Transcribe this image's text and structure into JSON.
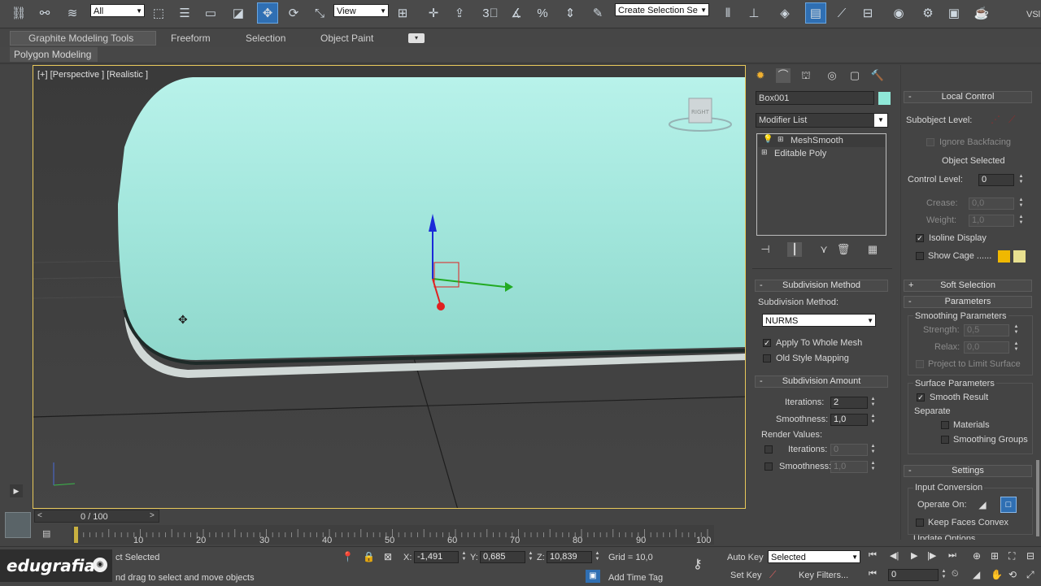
{
  "toolbar": {
    "selection_filter": "All",
    "ref_coord": "View",
    "named_selection_placeholder": "Create Selection Se",
    "icons": [
      "link-icon",
      "unlink-icon",
      "bind-spacewarp-icon",
      "select-object-icon",
      "select-by-name-icon",
      "rect-selection-icon",
      "window-crossing-icon",
      "move-icon",
      "rotate-icon",
      "scale-icon",
      "mirror-snap-icon",
      "pivot-icon",
      "snap-3-icon",
      "angle-snap-icon",
      "percent-snap-icon",
      "spinner-snap-icon",
      "edit-named-sets-icon",
      "mirror-icon",
      "align-icon",
      "layer-icon",
      "graphite-icon",
      "curve-editor-icon",
      "schematic-icon",
      "material-editor-icon",
      "render-setup-icon",
      "render-frame-icon",
      "teapot-icon",
      "render-icon"
    ],
    "right_label": "VSl"
  },
  "ribbon": {
    "tabs": [
      "Graphite Modeling Tools",
      "Freeform",
      "Selection",
      "Object Paint"
    ],
    "sub_tab": "Polygon Modeling"
  },
  "viewport": {
    "label": "[+] [Perspective ] [Realistic ]",
    "viewcube_label": "RIGHT"
  },
  "command_panel": {
    "object_name": "Box001",
    "modifier_list": "Modifier List",
    "stack": [
      "MeshSmooth",
      "Editable Poly"
    ],
    "subdivision_method": {
      "title": "Subdivision Method",
      "label": "Subdivision Method:",
      "value": "NURMS",
      "apply_whole_mesh": "Apply To Whole Mesh",
      "old_style_mapping": "Old Style Mapping"
    },
    "subdivision_amount": {
      "title": "Subdivision Amount",
      "iterations_label": "Iterations:",
      "iterations_value": "2",
      "smoothness_label": "Smoothness:",
      "smoothness_value": "1,0",
      "render_values": "Render Values:",
      "r_iterations_value": "0",
      "r_smoothness_value": "1,0"
    }
  },
  "right_panel": {
    "local_control": {
      "title": "Local Control",
      "subobject_level": "Subobject Level:",
      "ignore_backfacing": "Ignore Backfacing",
      "object_selected": "Object Selected",
      "control_level_label": "Control Level:",
      "control_level_value": "0",
      "crease_label": "Crease:",
      "crease_value": "0,0",
      "weight_label": "Weight:",
      "weight_value": "1,0",
      "isoline_display": "Isoline Display",
      "show_cage": "Show Cage ......",
      "cage_color_1": "#f0b800",
      "cage_color_2": "#e8e090"
    },
    "soft_selection": {
      "title": "Soft Selection"
    },
    "parameters": {
      "title": "Parameters",
      "smoothing_params": "Smoothing Parameters",
      "strength_label": "Strength:",
      "strength_value": "0,5",
      "relax_label": "Relax:",
      "relax_value": "0,0",
      "project_limit": "Project to Limit Surface",
      "surface_params": "Surface Parameters",
      "smooth_result": "Smooth Result",
      "separate": "Separate",
      "materials": "Materials",
      "smoothing_groups": "Smoothing Groups"
    },
    "settings": {
      "title": "Settings",
      "input_conversion": "Input Conversion",
      "operate_on": "Operate On:",
      "keep_faces_convex": "Keep Faces Convex",
      "update_options": "Update Options"
    }
  },
  "timeline": {
    "frame_counter": "0 / 100",
    "ticks": [
      "10",
      "20",
      "30",
      "40",
      "50",
      "60",
      "70",
      "80",
      "90",
      "100"
    ]
  },
  "status": {
    "logo": "edugrafia",
    "selection_msg": "ct Selected",
    "prompt_msg": "nd drag to select and move objects",
    "x_label": "X:",
    "x_value": "-1,491",
    "y_label": "Y:",
    "y_value": "0,685",
    "z_label": "Z:",
    "z_value": "10,839",
    "grid": "Grid = 10,0",
    "add_time_tag": "Add Time Tag",
    "auto_key": "Auto Key",
    "set_key": "Set Key",
    "key_mode": "Selected",
    "key_filters": "Key Filters...",
    "current_frame": "0"
  },
  "colors": {
    "mesh": "#a4e8df",
    "active_blue": "#2f6fb3",
    "object_color": "#8fe8d8"
  }
}
